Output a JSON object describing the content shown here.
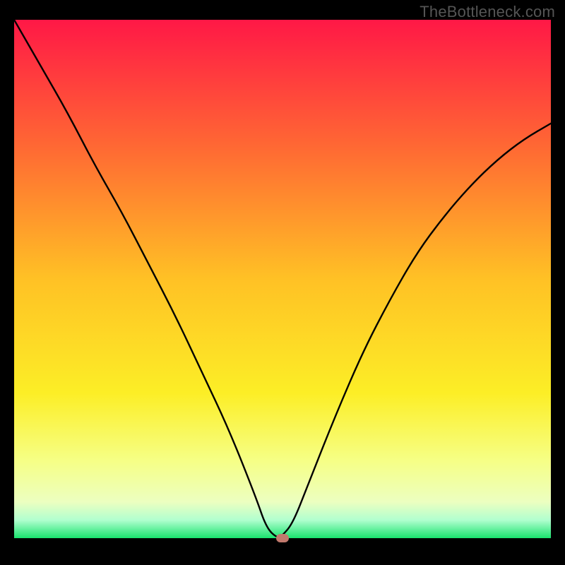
{
  "watermark": "TheBottleneck.com",
  "chart_data": {
    "type": "line",
    "title": "",
    "xlabel": "",
    "ylabel": "",
    "xlim": [
      0,
      100
    ],
    "ylim": [
      0,
      100
    ],
    "grid": false,
    "legend": false,
    "series": [
      {
        "name": "bottleneck-curve",
        "x": [
          0,
          5,
          10,
          15,
          20,
          25,
          30,
          35,
          40,
          45,
          47,
          49,
          50,
          52,
          55,
          60,
          65,
          70,
          75,
          80,
          85,
          90,
          95,
          100
        ],
        "values": [
          100,
          91,
          82,
          72,
          63,
          53,
          43,
          32,
          21,
          8,
          2,
          0,
          0.5,
          3,
          11,
          24,
          36,
          46,
          55,
          62,
          68,
          73,
          77,
          80
        ]
      }
    ],
    "annotations": [
      {
        "name": "optimal-marker",
        "x": 50,
        "y": 0
      }
    ],
    "background_gradient": {
      "stops": [
        {
          "offset": 0.0,
          "color": "#ff1846"
        },
        {
          "offset": 0.25,
          "color": "#ff6a33"
        },
        {
          "offset": 0.5,
          "color": "#ffc125"
        },
        {
          "offset": 0.72,
          "color": "#fcee26"
        },
        {
          "offset": 0.85,
          "color": "#f6ff85"
        },
        {
          "offset": 0.93,
          "color": "#ecffc0"
        },
        {
          "offset": 0.965,
          "color": "#b1ffcf"
        },
        {
          "offset": 1.0,
          "color": "#19e36e"
        }
      ]
    }
  }
}
